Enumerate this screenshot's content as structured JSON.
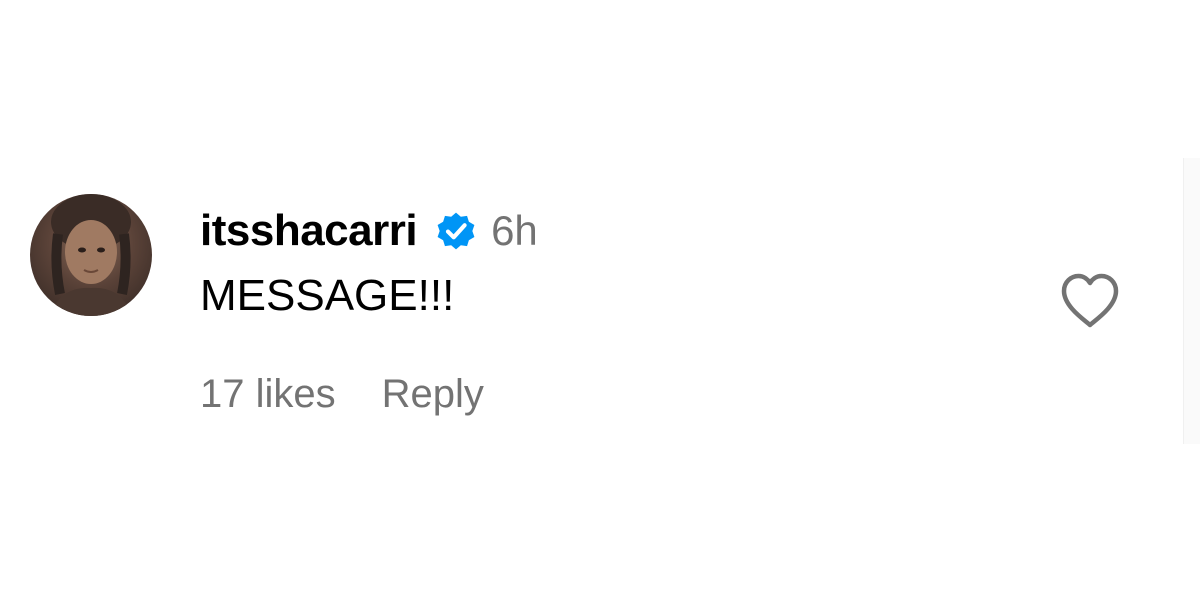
{
  "comment": {
    "username": "itsshacarri",
    "verified": true,
    "timestamp": "6h",
    "text": "MESSAGE!!!",
    "likes_label": "17 likes",
    "reply_label": "Reply",
    "avatar_icon": "profile-photo",
    "like_icon": "heart-outline-icon"
  },
  "colors": {
    "verified_badge": "#0095f6",
    "secondary_text": "#737373",
    "primary_text": "#000000",
    "heart_stroke": "#737373"
  }
}
